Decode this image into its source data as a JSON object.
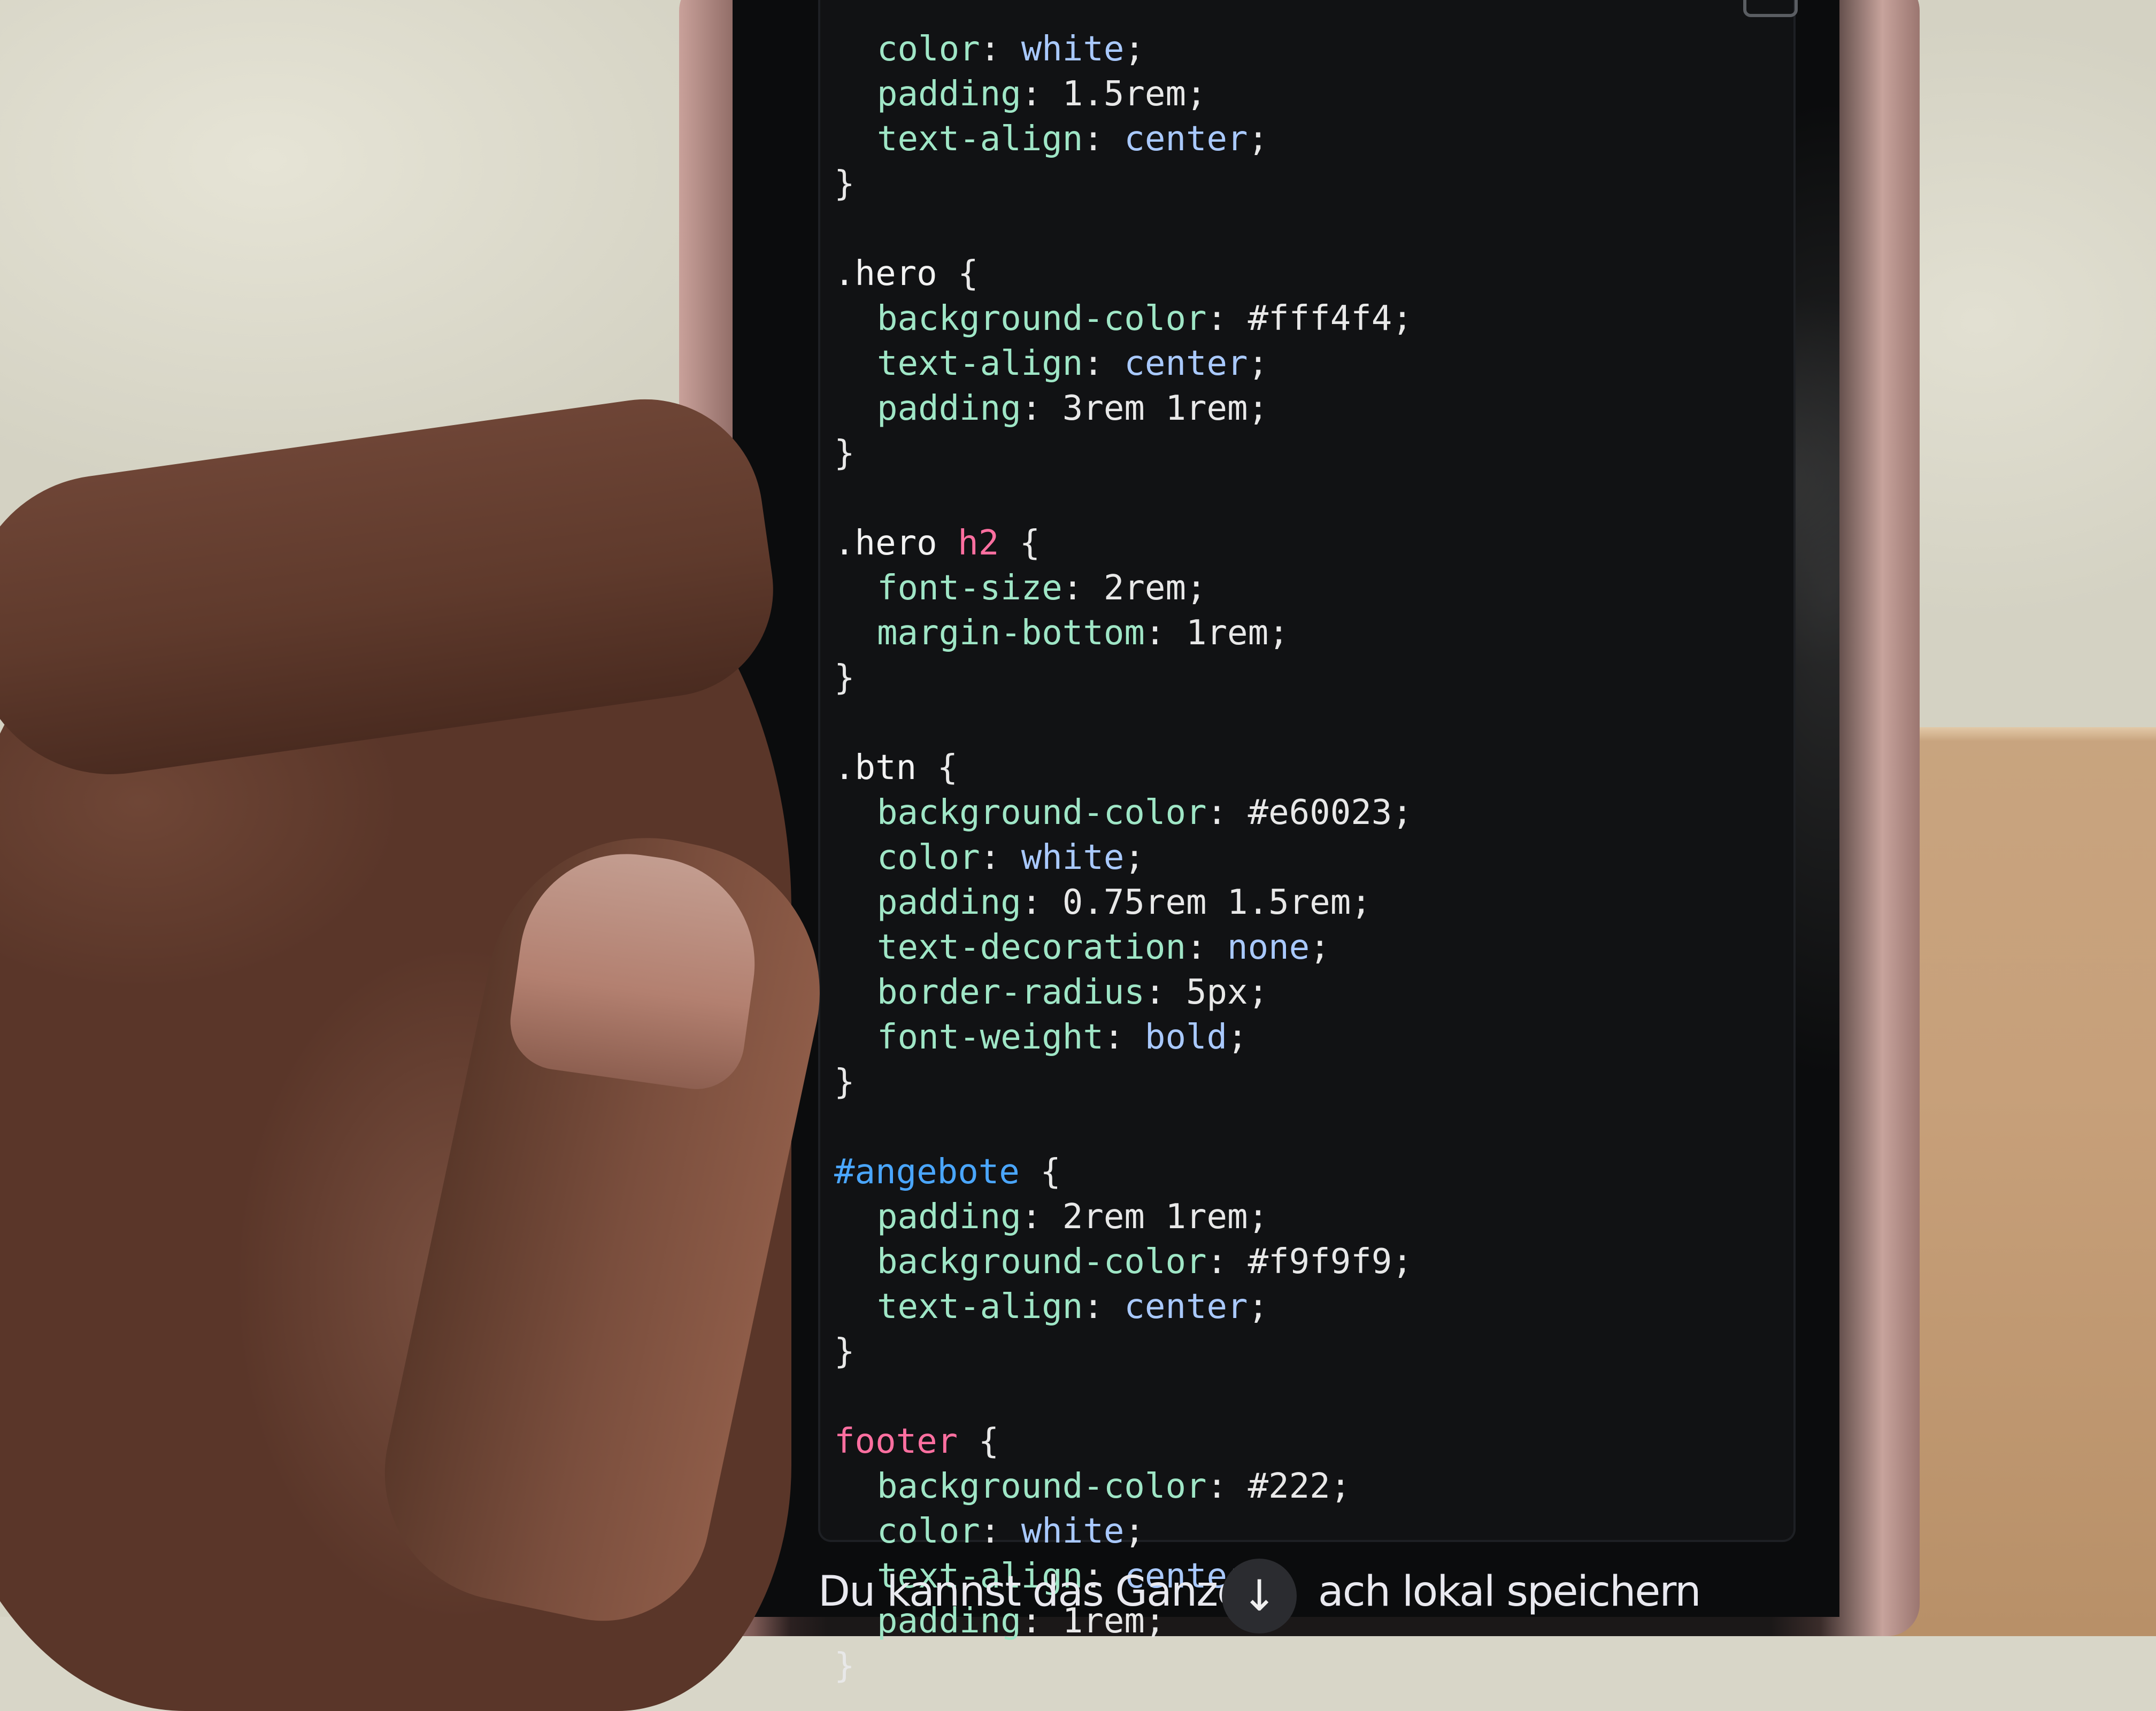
{
  "scene": {
    "description_free": true
  },
  "code_block": {
    "lines": [
      {
        "indent": 1,
        "parts": [
          {
            "k": "prop",
            "t": "color"
          },
          {
            "k": "punc",
            "t": ": "
          },
          {
            "k": "kw",
            "t": "white"
          },
          {
            "k": "punc",
            "t": ";"
          }
        ]
      },
      {
        "indent": 1,
        "parts": [
          {
            "k": "prop",
            "t": "padding"
          },
          {
            "k": "punc",
            "t": ": "
          },
          {
            "k": "val",
            "t": "1.5rem"
          },
          {
            "k": "punc",
            "t": ";"
          }
        ]
      },
      {
        "indent": 1,
        "parts": [
          {
            "k": "prop",
            "t": "text-align"
          },
          {
            "k": "punc",
            "t": ": "
          },
          {
            "k": "kw",
            "t": "center"
          },
          {
            "k": "punc",
            "t": ";"
          }
        ]
      },
      {
        "indent": 0,
        "parts": [
          {
            "k": "punc",
            "t": "}"
          }
        ]
      },
      {
        "indent": 0,
        "parts": []
      },
      {
        "indent": 0,
        "parts": [
          {
            "k": "sel",
            "t": ".hero"
          },
          {
            "k": "punc",
            "t": " {"
          }
        ]
      },
      {
        "indent": 1,
        "parts": [
          {
            "k": "prop",
            "t": "background-color"
          },
          {
            "k": "punc",
            "t": ": "
          },
          {
            "k": "val",
            "t": "#fff4f4"
          },
          {
            "k": "punc",
            "t": ";"
          }
        ]
      },
      {
        "indent": 1,
        "parts": [
          {
            "k": "prop",
            "t": "text-align"
          },
          {
            "k": "punc",
            "t": ": "
          },
          {
            "k": "kw",
            "t": "center"
          },
          {
            "k": "punc",
            "t": ";"
          }
        ]
      },
      {
        "indent": 1,
        "parts": [
          {
            "k": "prop",
            "t": "padding"
          },
          {
            "k": "punc",
            "t": ": "
          },
          {
            "k": "val",
            "t": "3rem 1rem"
          },
          {
            "k": "punc",
            "t": ";"
          }
        ]
      },
      {
        "indent": 0,
        "parts": [
          {
            "k": "punc",
            "t": "}"
          }
        ]
      },
      {
        "indent": 0,
        "parts": []
      },
      {
        "indent": 0,
        "parts": [
          {
            "k": "sel",
            "t": ".hero "
          },
          {
            "k": "tag",
            "t": "h2"
          },
          {
            "k": "punc",
            "t": " {"
          }
        ]
      },
      {
        "indent": 1,
        "parts": [
          {
            "k": "prop",
            "t": "font-size"
          },
          {
            "k": "punc",
            "t": ": "
          },
          {
            "k": "val",
            "t": "2rem"
          },
          {
            "k": "punc",
            "t": ";"
          }
        ]
      },
      {
        "indent": 1,
        "parts": [
          {
            "k": "prop",
            "t": "margin-bottom"
          },
          {
            "k": "punc",
            "t": ": "
          },
          {
            "k": "val",
            "t": "1rem"
          },
          {
            "k": "punc",
            "t": ";"
          }
        ]
      },
      {
        "indent": 0,
        "parts": [
          {
            "k": "punc",
            "t": "}"
          }
        ]
      },
      {
        "indent": 0,
        "parts": []
      },
      {
        "indent": 0,
        "parts": [
          {
            "k": "sel",
            "t": ".btn"
          },
          {
            "k": "punc",
            "t": " {"
          }
        ]
      },
      {
        "indent": 1,
        "parts": [
          {
            "k": "prop",
            "t": "background-color"
          },
          {
            "k": "punc",
            "t": ": "
          },
          {
            "k": "val",
            "t": "#e60023"
          },
          {
            "k": "punc",
            "t": ";"
          }
        ]
      },
      {
        "indent": 1,
        "parts": [
          {
            "k": "prop",
            "t": "color"
          },
          {
            "k": "punc",
            "t": ": "
          },
          {
            "k": "kw",
            "t": "white"
          },
          {
            "k": "punc",
            "t": ";"
          }
        ]
      },
      {
        "indent": 1,
        "parts": [
          {
            "k": "prop",
            "t": "padding"
          },
          {
            "k": "punc",
            "t": ": "
          },
          {
            "k": "val",
            "t": "0.75rem 1.5rem"
          },
          {
            "k": "punc",
            "t": ";"
          }
        ]
      },
      {
        "indent": 1,
        "parts": [
          {
            "k": "prop",
            "t": "text-decoration"
          },
          {
            "k": "punc",
            "t": ": "
          },
          {
            "k": "kw",
            "t": "none"
          },
          {
            "k": "punc",
            "t": ";"
          }
        ]
      },
      {
        "indent": 1,
        "parts": [
          {
            "k": "prop",
            "t": "border-radius"
          },
          {
            "k": "punc",
            "t": ": "
          },
          {
            "k": "val",
            "t": "5px"
          },
          {
            "k": "punc",
            "t": ";"
          }
        ]
      },
      {
        "indent": 1,
        "parts": [
          {
            "k": "prop",
            "t": "font-weight"
          },
          {
            "k": "punc",
            "t": ": "
          },
          {
            "k": "kw",
            "t": "bold"
          },
          {
            "k": "punc",
            "t": ";"
          }
        ]
      },
      {
        "indent": 0,
        "parts": [
          {
            "k": "punc",
            "t": "}"
          }
        ]
      },
      {
        "indent": 0,
        "parts": []
      },
      {
        "indent": 0,
        "parts": [
          {
            "k": "id",
            "t": "#angebote"
          },
          {
            "k": "punc",
            "t": " {"
          }
        ]
      },
      {
        "indent": 1,
        "parts": [
          {
            "k": "prop",
            "t": "padding"
          },
          {
            "k": "punc",
            "t": ": "
          },
          {
            "k": "val",
            "t": "2rem 1rem"
          },
          {
            "k": "punc",
            "t": ";"
          }
        ]
      },
      {
        "indent": 1,
        "parts": [
          {
            "k": "prop",
            "t": "background-color"
          },
          {
            "k": "punc",
            "t": ": "
          },
          {
            "k": "val",
            "t": "#f9f9f9"
          },
          {
            "k": "punc",
            "t": ";"
          }
        ]
      },
      {
        "indent": 1,
        "parts": [
          {
            "k": "prop",
            "t": "text-align"
          },
          {
            "k": "punc",
            "t": ": "
          },
          {
            "k": "kw",
            "t": "center"
          },
          {
            "k": "punc",
            "t": ";"
          }
        ]
      },
      {
        "indent": 0,
        "parts": [
          {
            "k": "punc",
            "t": "}"
          }
        ]
      },
      {
        "indent": 0,
        "parts": []
      },
      {
        "indent": 0,
        "parts": [
          {
            "k": "tag",
            "t": "footer"
          },
          {
            "k": "punc",
            "t": " {"
          }
        ]
      },
      {
        "indent": 1,
        "parts": [
          {
            "k": "prop",
            "t": "background-color"
          },
          {
            "k": "punc",
            "t": ": "
          },
          {
            "k": "val",
            "t": "#222"
          },
          {
            "k": "punc",
            "t": ";"
          }
        ]
      },
      {
        "indent": 1,
        "parts": [
          {
            "k": "prop",
            "t": "color"
          },
          {
            "k": "punc",
            "t": ": "
          },
          {
            "k": "kw",
            "t": "white"
          },
          {
            "k": "punc",
            "t": ";"
          }
        ]
      },
      {
        "indent": 1,
        "parts": [
          {
            "k": "prop",
            "t": "text-align"
          },
          {
            "k": "punc",
            "t": ": "
          },
          {
            "k": "kw",
            "t": "center"
          },
          {
            "k": "punc",
            "t": ";"
          }
        ]
      },
      {
        "indent": 1,
        "parts": [
          {
            "k": "prop",
            "t": "padding"
          },
          {
            "k": "punc",
            "t": ": "
          },
          {
            "k": "val",
            "t": "1rem"
          },
          {
            "k": "punc",
            "t": ";"
          }
        ]
      },
      {
        "indent": 0,
        "parts": [
          {
            "k": "punc",
            "t": "}"
          }
        ]
      }
    ]
  },
  "message": {
    "text_before": "Du kannst das Ganze ",
    "text_after": "ach lokal speichern"
  },
  "scroll_button": {
    "icon": "arrow-down-icon",
    "glyph": "↓"
  },
  "colors": {
    "code_background": "#111214",
    "property": "#9fe6c6",
    "keyword": "#a9c9ff",
    "tag": "#ff6fa0",
    "id_selector": "#4aa6ff"
  }
}
